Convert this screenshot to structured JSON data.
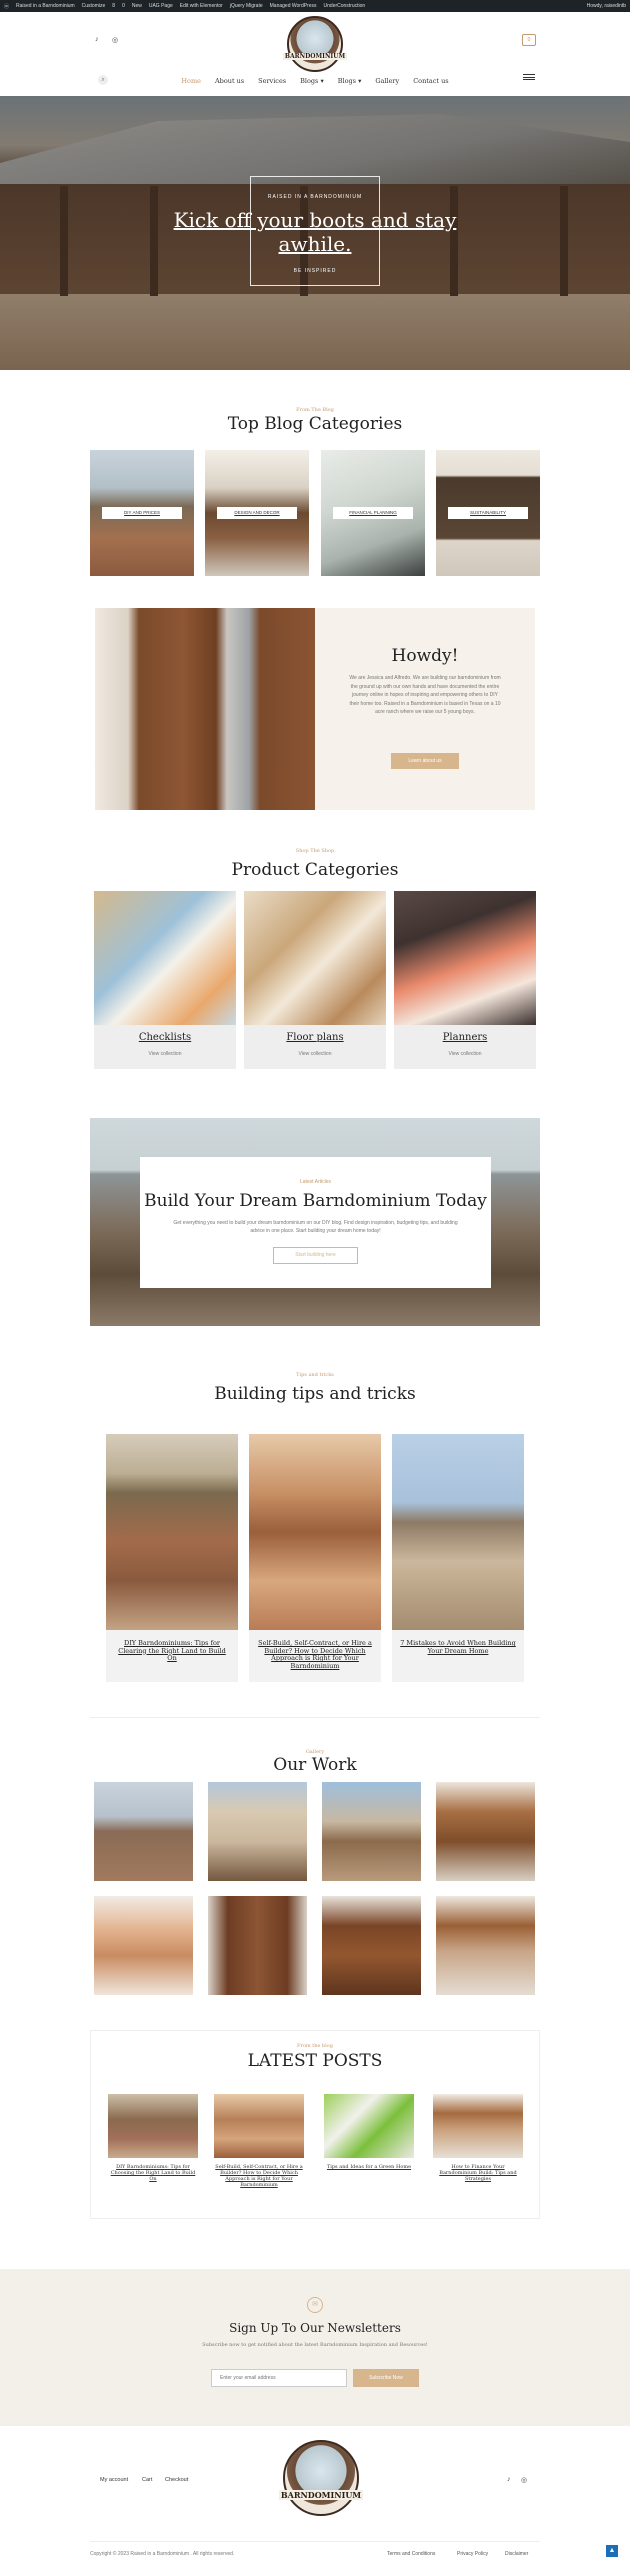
{
  "admin_bar": {
    "items": [
      "Raised in a Barndominium",
      "Customize",
      "8",
      "0",
      "New",
      "UAG Page",
      "Edit with Elementor",
      "jQuery Migrate",
      "Managed WordPress",
      "UnderConstruction"
    ],
    "user": "Howdy, raisedintb"
  },
  "header": {
    "logo_text": "BARNDOMINIUM",
    "nav": [
      "Home",
      "About us",
      "Services",
      "Blogs ▾",
      "Blogs ▾",
      "Gallery",
      "Contact us"
    ],
    "cart_count": "0"
  },
  "hero": {
    "tag": "RAISED IN A BARNDOMINIUM",
    "title": "Kick off your boots and stay awhile.",
    "button": "BE INSPIRED"
  },
  "blog_categories": {
    "eyebrow": "From The Blog",
    "title": "Top Blog Categories",
    "items": [
      "DIY AND PRICES",
      "DESIGN AND DECOR",
      "FINANCIAL PLANNING",
      "SUSTAINABILITY"
    ]
  },
  "howdy": {
    "title": "Howdy!",
    "text": "We are Jessica and Alfredo. We are building our barndominium from the ground up with our own hands and have documented the entire journey online in hopes of inspiring and empowering others to DIY their home too. Raised in a Barndominium is based in Texas on a 10 acre ranch where we raise our 5 young boys.",
    "button": "Learn about us"
  },
  "product_categories": {
    "eyebrow": "Shop The Shop",
    "title": "Product Categories",
    "items": [
      {
        "title": "Checklists",
        "sub": "View collection"
      },
      {
        "title": "Floor plans",
        "sub": "View collection"
      },
      {
        "title": "Planners",
        "sub": "View collection"
      }
    ]
  },
  "dream": {
    "eyebrow": "Latest Articles",
    "title": "Build Your Dream Barndominium Today",
    "text": "Get everything you need to build your dream barndominium on our DIY blog. Find design inspiration, budgeting tips, and building advice in one place. Start building your dream home today!",
    "button": "Start building here"
  },
  "tips": {
    "eyebrow": "Tips and tricks",
    "title": "Building tips and tricks",
    "items": [
      "DIY Barndominiums: Tips for Clearing the Right Land to Build On",
      "Self-Build, Self-Contract, or Hire a Builder? How to Decide Which Approach is Right for Your Barndominium",
      "7 Mistakes to Avoid When Building Your Dream Home"
    ]
  },
  "work": {
    "eyebrow": "Gallery",
    "title": "Our Work"
  },
  "latest": {
    "eyebrow": "From the blog",
    "title": "LATEST POSTS",
    "items": [
      "DIY Barndominiums: Tips for Choosing the Right Land to Build On",
      "Self-Build, Self-Contract, or Hire a Builder? How to Decide Which Approach is Right for Your Barndominium",
      "Tips and Ideas for a Green Home",
      "How to Finance Your Barndominium Build: Tips and Strategies"
    ]
  },
  "newsletter": {
    "title": "Sign Up To Our Newsletters",
    "text": "Subscribe now to get notified about the latest Barndominium Inspiration and Resources!",
    "placeholder": "Enter your email address",
    "button": "Subscribe Now"
  },
  "footer": {
    "links": [
      "My account",
      "Cart",
      "Checkout"
    ],
    "logo_text": "BARNDOMINIUM",
    "copyright": "Copyright © 2023 Raised in a Barndominium . All rights reserved.",
    "legal": [
      "Terms and Conditions",
      "Privacy Policy",
      "Disclaimer"
    ]
  },
  "colors": {
    "accent": "#c49a6c",
    "button": "#d7b58d",
    "dark": "#1d2327"
  }
}
